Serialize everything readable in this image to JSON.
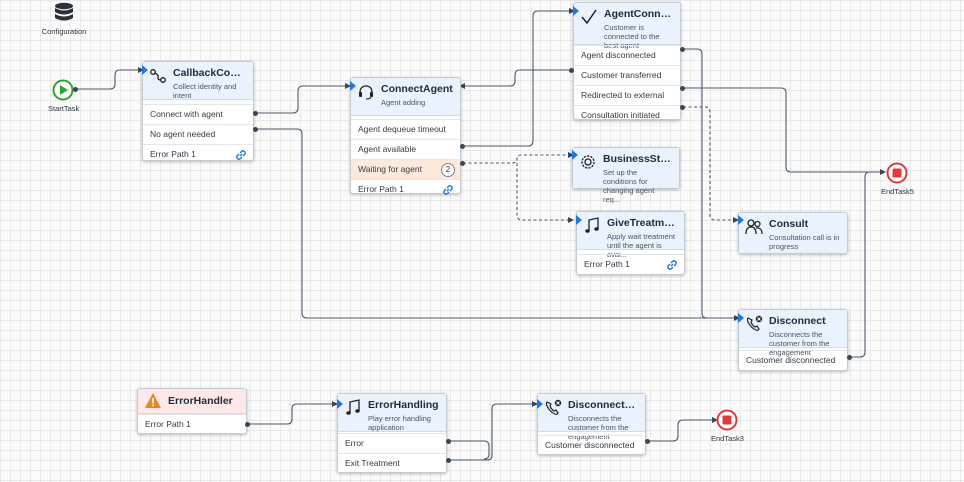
{
  "config": {
    "label": "Configuration"
  },
  "start": {
    "label": "StartTask"
  },
  "end5": {
    "label": "EndTask5"
  },
  "end3": {
    "label": "EndTask3"
  },
  "callback": {
    "title": "CallbackConfirm...",
    "desc": "Collect identity and intent",
    "rows": [
      "Connect with agent",
      "No agent needed",
      "Error Path 1"
    ]
  },
  "connect": {
    "title": "ConnectAgent",
    "desc": "Agent adding",
    "rows": [
      "Agent dequeue timeout",
      "Agent available",
      "Waiting for agent",
      "Error Path 1"
    ],
    "badge": "2"
  },
  "connected": {
    "title": "AgentConnected",
    "desc": "Customer is connected to the best agent",
    "rows": [
      "Agent disconnected",
      "Customer transferred",
      "Redirected to external",
      "Consultation initiated"
    ]
  },
  "business": {
    "title": "BusinessStrategy",
    "desc": "Set up the conditions for changing agent req..."
  },
  "treatment": {
    "title": "GiveTreatment",
    "desc": "Apply wait treatment until the agent is avai...",
    "rows": [
      "Error Path 1"
    ]
  },
  "consult": {
    "title": "Consult",
    "desc": "Consultation call is in progress"
  },
  "disconnect": {
    "title": "Disconnect",
    "desc": "Disconnects the customer from the engagement",
    "rows": [
      "Customer disconnected"
    ]
  },
  "errhandler": {
    "title": "ErrorHandler",
    "rows": [
      "Error Path 1"
    ]
  },
  "errhandling": {
    "title": "ErrorHandling",
    "desc": "Play error handling application",
    "rows": [
      "Error",
      "Exit Treatment"
    ]
  },
  "disconnect_err": {
    "title": "DisconnectOnEr...",
    "desc": "Disconnects the customer from the engagement",
    "rows": [
      "Customer disconnected"
    ]
  },
  "colors": {
    "accent": "#1f77e0",
    "start": "#2fa52f",
    "end": "#e03a3a",
    "warning": "#e8862a"
  }
}
